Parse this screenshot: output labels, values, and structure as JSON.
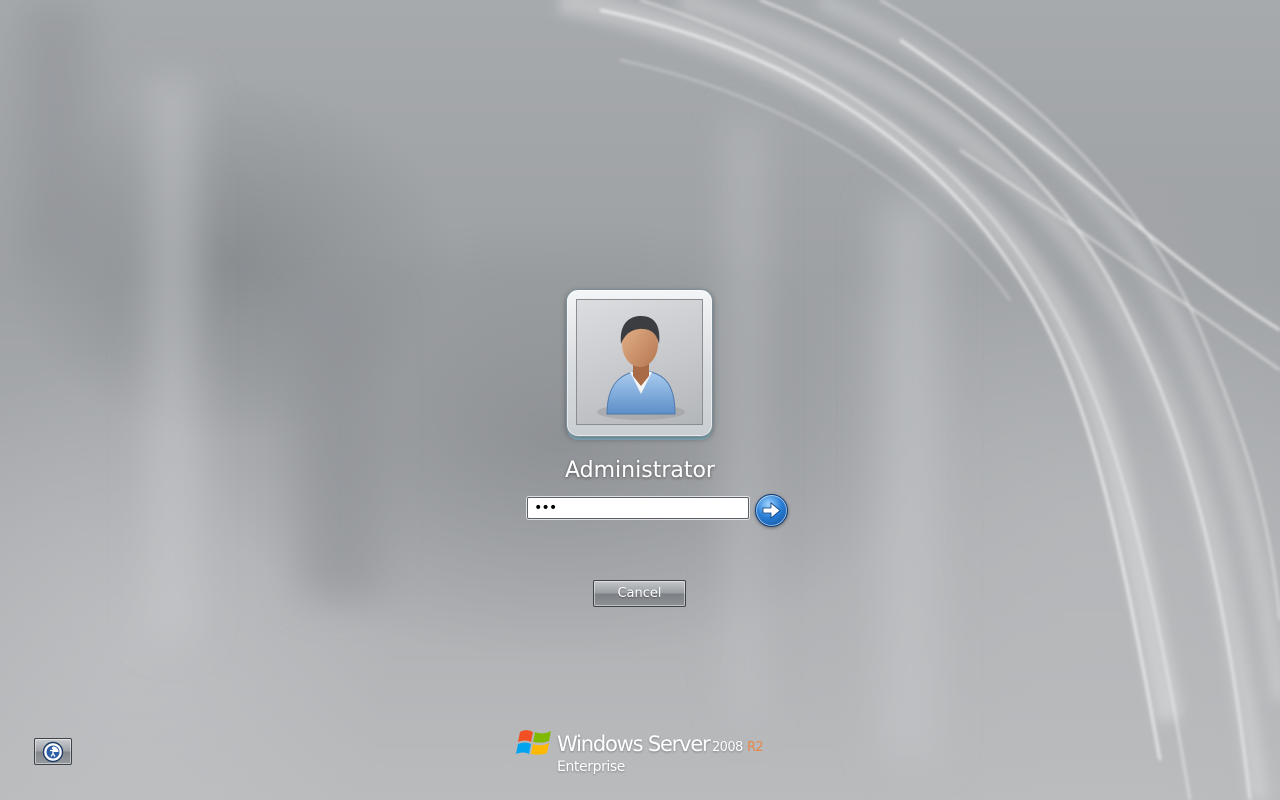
{
  "user": {
    "name": "Administrator",
    "avatar_icon": "user-avatar-icon"
  },
  "password": {
    "masked_value": "•••",
    "type": "password"
  },
  "submit": {
    "icon": "arrow-right-icon"
  },
  "cancel": {
    "label": "Cancel"
  },
  "ease_of_access": {
    "icon": "ease-of-access-icon"
  },
  "branding": {
    "logo_icon": "windows-flag-icon",
    "product_name": "Windows Server",
    "version": "2008",
    "release": "R2",
    "edition": "Enterprise"
  },
  "colors": {
    "background": "#a7aaad",
    "accent_blue": "#2a7fd6",
    "r2_orange": "#e8874a",
    "text": "#ffffff"
  }
}
